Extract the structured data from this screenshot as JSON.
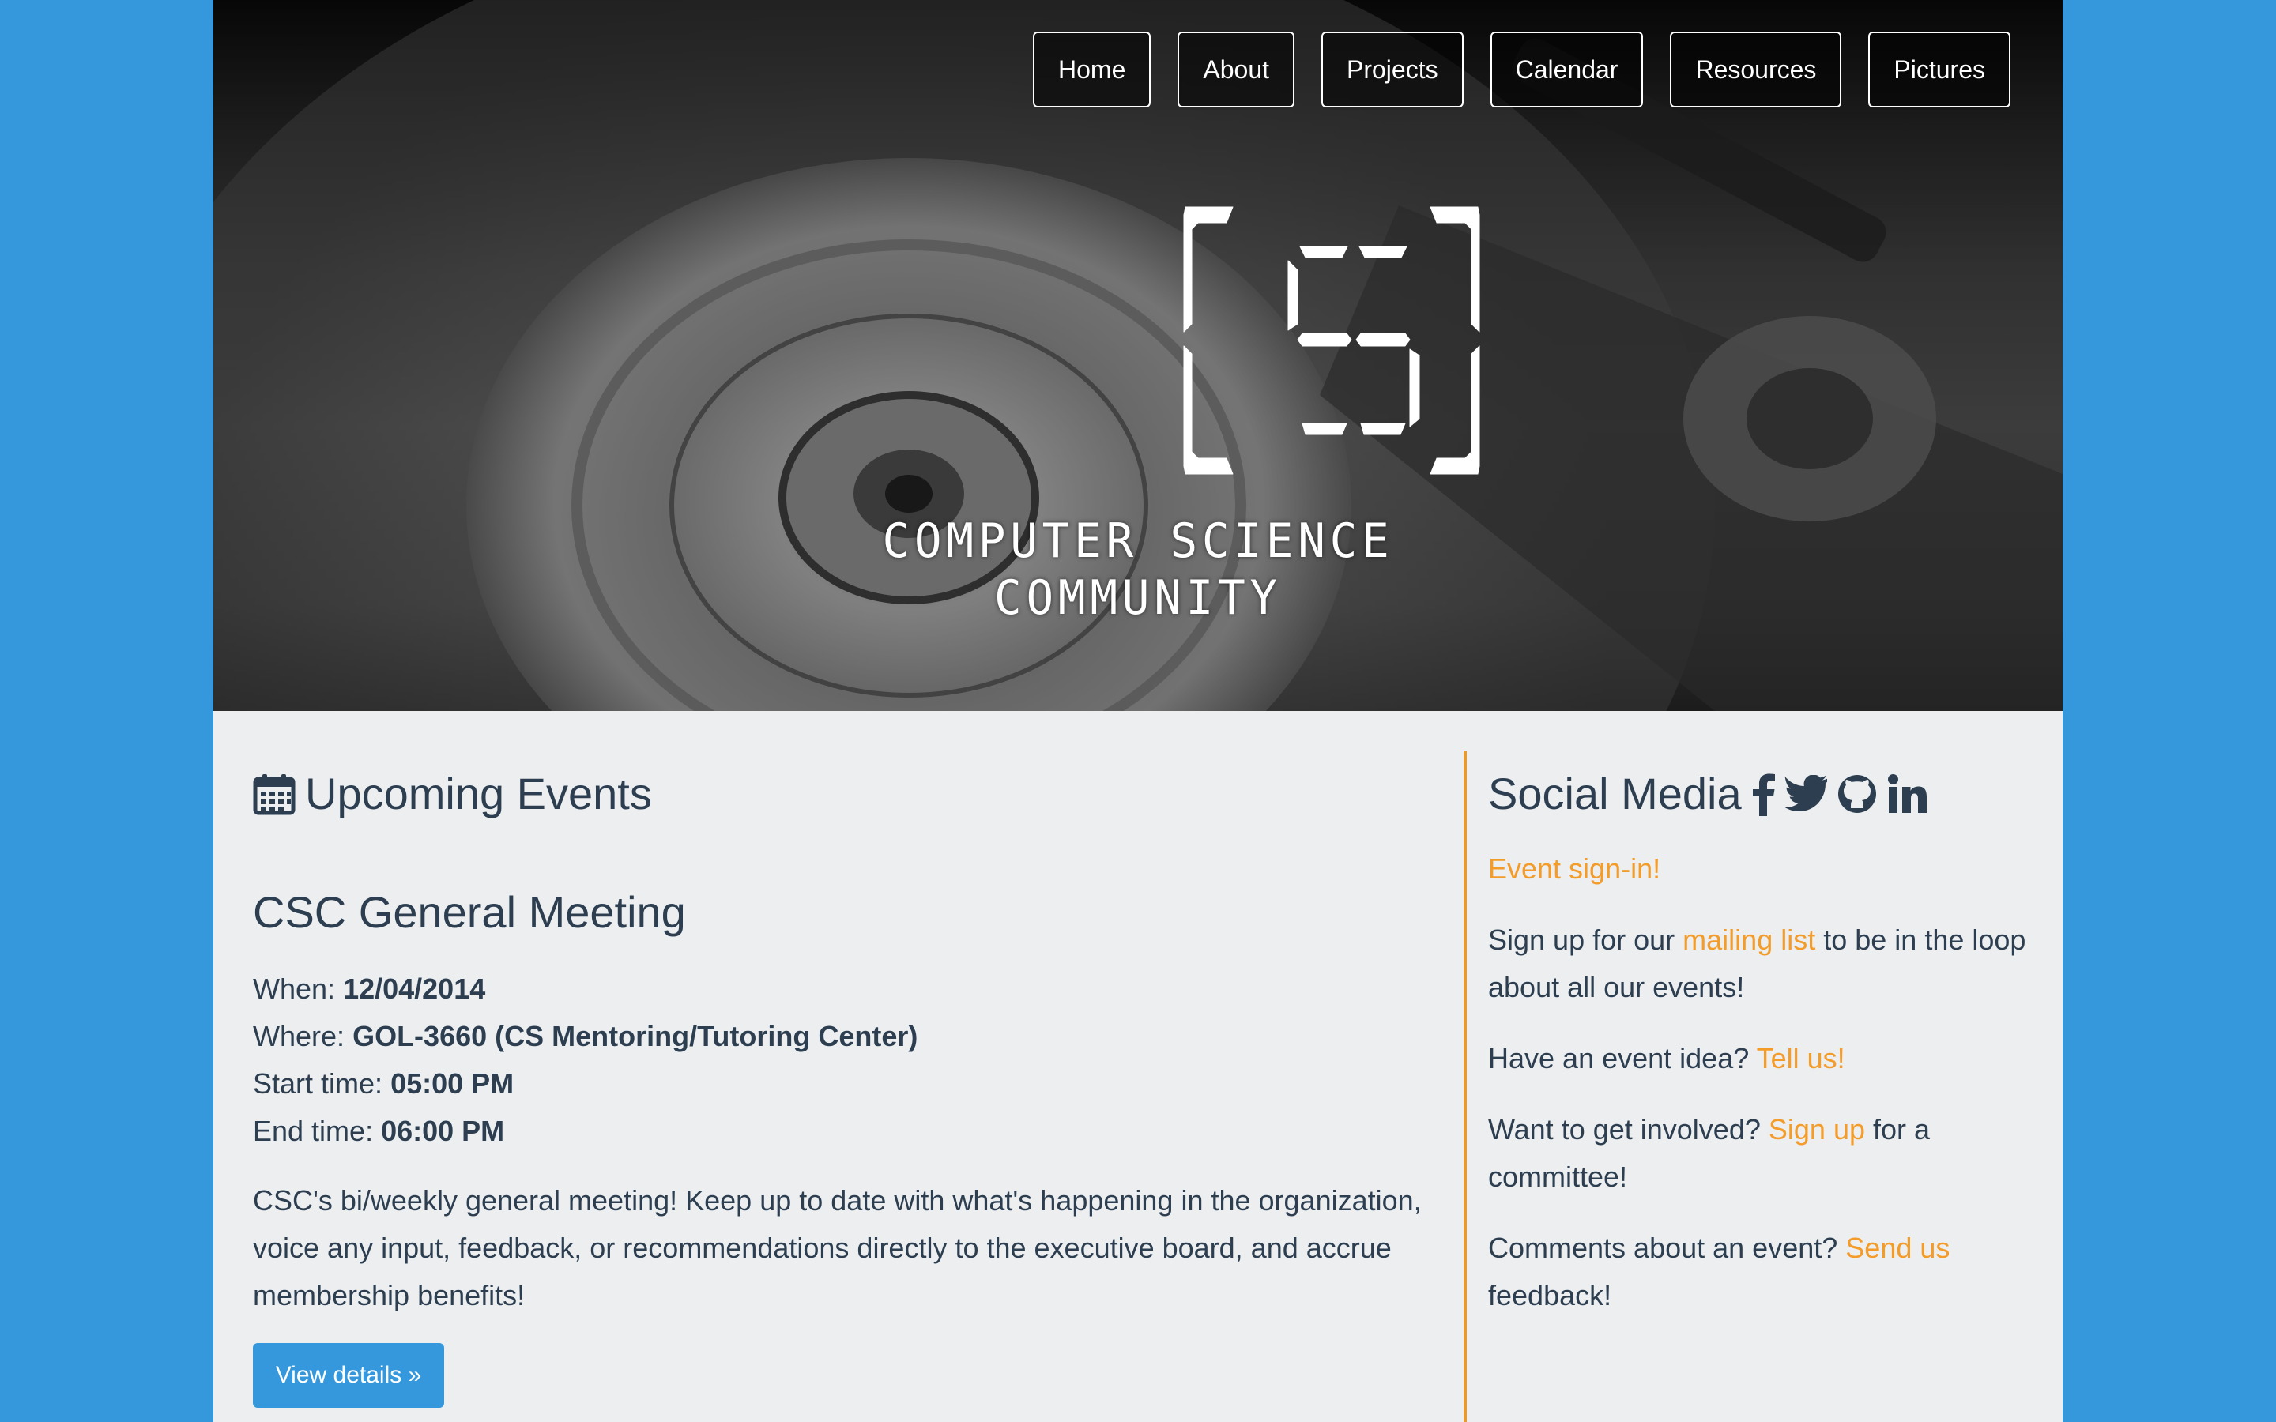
{
  "nav": {
    "items": [
      "Home",
      "About",
      "Projects",
      "Calendar",
      "Resources",
      "Pictures"
    ]
  },
  "hero": {
    "logo_text": "[S]",
    "tagline_line1": "COMPUTER SCIENCE",
    "tagline_line2": "COMMUNITY"
  },
  "events": {
    "heading": "Upcoming Events",
    "icon": "calendar-icon",
    "event": {
      "title": "CSC General Meeting",
      "when_label": "When:",
      "when_value": "12/04/2014",
      "where_label": "Where:",
      "where_value": "GOL-3660 (CS Mentoring/Tutoring Center)",
      "start_label": "Start time:",
      "start_value": "05:00 PM",
      "end_label": "End time:",
      "end_value": "06:00 PM",
      "description": "CSC's bi/weekly general meeting! Keep up to date with what's happening in the organization, voice any input, feedback, or recommendations directly to the executive board, and accrue membership benefits!",
      "button": "View details »"
    }
  },
  "social": {
    "heading": "Social Media",
    "icons": [
      "facebook-icon",
      "twitter-icon",
      "github-icon",
      "linkedin-icon"
    ],
    "event_signin": "Event sign-in!",
    "mailing_pre": "Sign up for our",
    "mailing_link": "mailing list",
    "mailing_post": "to be in the loop about all our events!",
    "idea_pre": "Have an event idea?",
    "idea_link": "Tell us!",
    "involved_pre": "Want to get involved?",
    "involved_link": "Sign up",
    "involved_post": "for a committee!",
    "comments_pre": "Comments about an event?",
    "comments_link": "Send us",
    "comments_post": "feedback!"
  },
  "colors": {
    "outer_background": "#3598dc",
    "content_background": "#eceef0",
    "text": "#2c3e50",
    "link": "#f39c2a",
    "divider": "#e59b33",
    "button": "#3598dc"
  }
}
